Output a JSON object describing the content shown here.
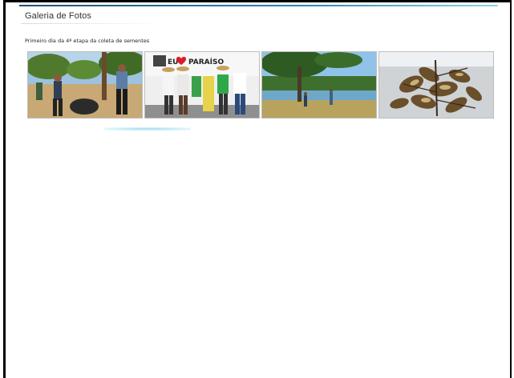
{
  "gallery": {
    "title": "Galeria de Fotos",
    "caption": "Primeiro dia da 4ª etapa da coleta de sementes",
    "photos": [
      {
        "icon": "photo-people-orchard"
      },
      {
        "icon": "photo-group-eu-amo-paraiso",
        "sign_text_1": "EU",
        "sign_text_2": "PARAÍSO"
      },
      {
        "icon": "photo-lake-tree"
      },
      {
        "icon": "photo-seed-pods"
      }
    ]
  },
  "colors": {
    "accent": "#2a89b8",
    "pager": "#9fdff0"
  }
}
